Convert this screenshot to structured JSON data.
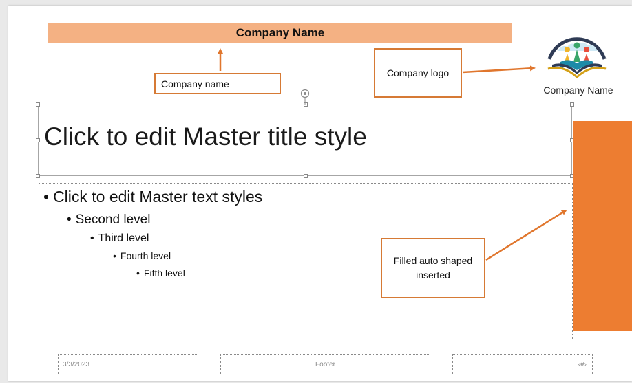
{
  "banner": {
    "title": "Company Name"
  },
  "callouts": {
    "company_name": "Company name",
    "company_logo": "Company logo",
    "filled_shape_line1": "Filled auto shaped",
    "filled_shape_line2": "inserted"
  },
  "logo": {
    "caption": "Company Name",
    "icon": "open-book-people-icon"
  },
  "master": {
    "title": "Click to edit Master title style",
    "levels": [
      "Click to edit Master text styles",
      "Second level",
      "Third level",
      "Fourth level",
      "Fifth level"
    ]
  },
  "footer": {
    "date": "3/3/2023",
    "text": "Footer",
    "slide_number": "‹#›"
  },
  "colors": {
    "banner": "#f4b183",
    "accent": "#ed7d31",
    "callout_border": "#d67a35"
  }
}
